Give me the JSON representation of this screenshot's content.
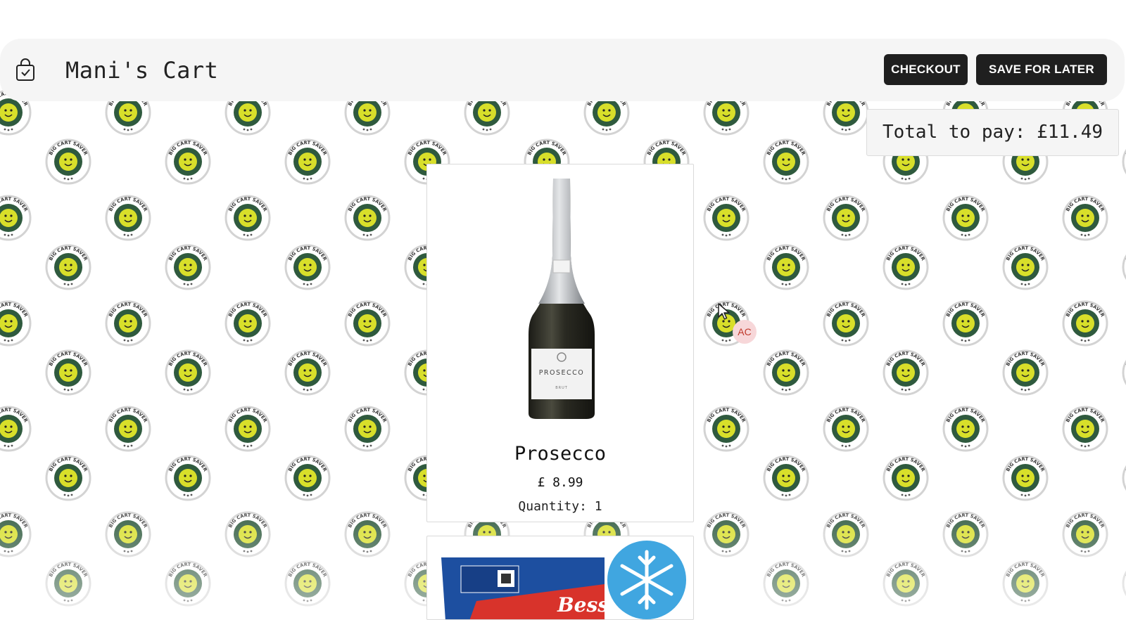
{
  "header": {
    "cart_title": "Mani's Cart",
    "cart_icon": "shopping-bag-check-icon",
    "checkout_label": "CHECKOUT",
    "save_for_later_label": "SAVE FOR LATER"
  },
  "total": {
    "label": "Total to pay: £11.49"
  },
  "background": {
    "badge_text": "BIG CART SAVER",
    "badge_color": "#2f5a3e",
    "mascot_color": "#d8df2a"
  },
  "products": [
    {
      "name": "Prosecco",
      "price": "£ 8.99",
      "quantity": "Quantity: 1",
      "label_text": "PROSECCO",
      "label_subtext": "BRUT"
    },
    {
      "name": "",
      "partial_image_text": "Bessie",
      "badge_icon": "snowflake-icon"
    }
  ],
  "presence": {
    "initials": "AC",
    "cursor_icon": "mouse-pointer-icon"
  }
}
